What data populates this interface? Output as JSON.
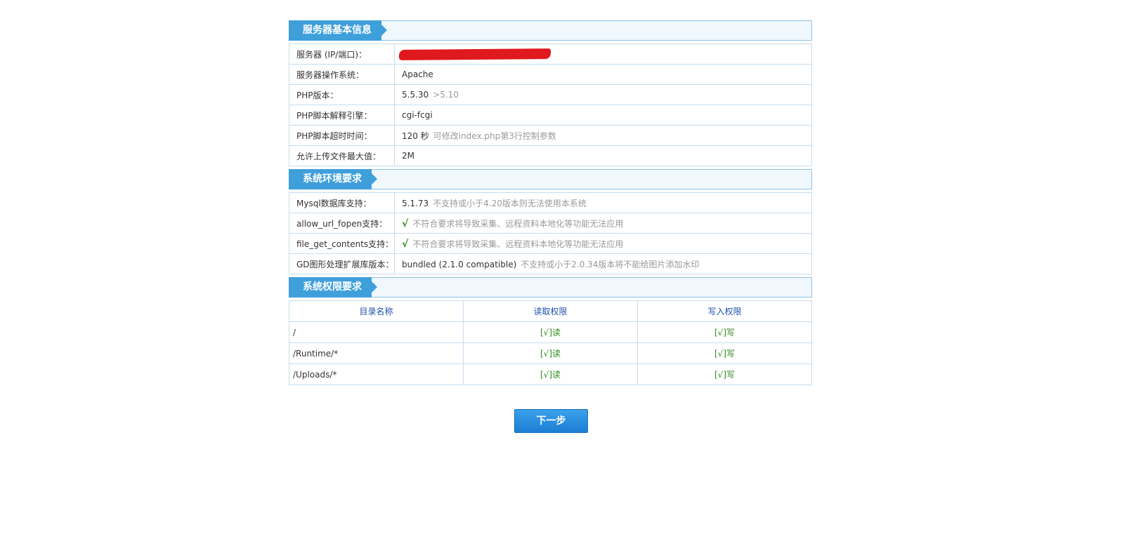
{
  "sections": {
    "basic": {
      "title": "服务器基本信息",
      "rows": [
        {
          "label": "服务器 (IP/端口)：",
          "value": ""
        },
        {
          "label": "服务器操作系统：",
          "value": "Apache"
        },
        {
          "label": "PHP版本：",
          "value": "5.5.30",
          "note": ">5.10"
        },
        {
          "label": "PHP脚本解释引擎：",
          "value": "cgi-fcgi"
        },
        {
          "label": "PHP脚本超时时间：",
          "value": "120 秒",
          "note": "可修改index.php第3行控制参数"
        },
        {
          "label": "允许上传文件最大值：",
          "value": "2M"
        }
      ]
    },
    "env": {
      "title": "系统环境要求",
      "rows": [
        {
          "label": "Mysql数据库支持：",
          "value": "5.1.73",
          "note": "不支持或小于4.20版本则无法使用本系统"
        },
        {
          "label": "allow_url_fopen支持：",
          "value": "√",
          "note": "不符合要求将导致采集、远程资料本地化等功能无法应用"
        },
        {
          "label": "file_get_contents支持：",
          "value": "√",
          "note": "不符合要求将导致采集、远程资料本地化等功能无法应用"
        },
        {
          "label": "GD图形处理扩展库版本：",
          "value": "bundled (2.1.0 compatible)",
          "note": "不支持或小于2.0.34版本将不能给图片添加水印"
        }
      ]
    },
    "perm": {
      "title": "系统权限要求",
      "headers": [
        "目录名称",
        "读取权限",
        "写入权限"
      ],
      "rows": [
        {
          "dir": "/",
          "read": "[√]读",
          "write": "[√]写"
        },
        {
          "dir": "/Runtime/*",
          "read": "[√]读",
          "write": "[√]写"
        },
        {
          "dir": "/Uploads/*",
          "read": "[√]读",
          "write": "[√]写"
        }
      ]
    }
  },
  "next_button": "下一步",
  "colors": {
    "section_tab": "#3f9fdb",
    "check_green": "#2a8a1a",
    "header_blue": "#1b4fa8",
    "redaction_red": "#e0191e"
  }
}
